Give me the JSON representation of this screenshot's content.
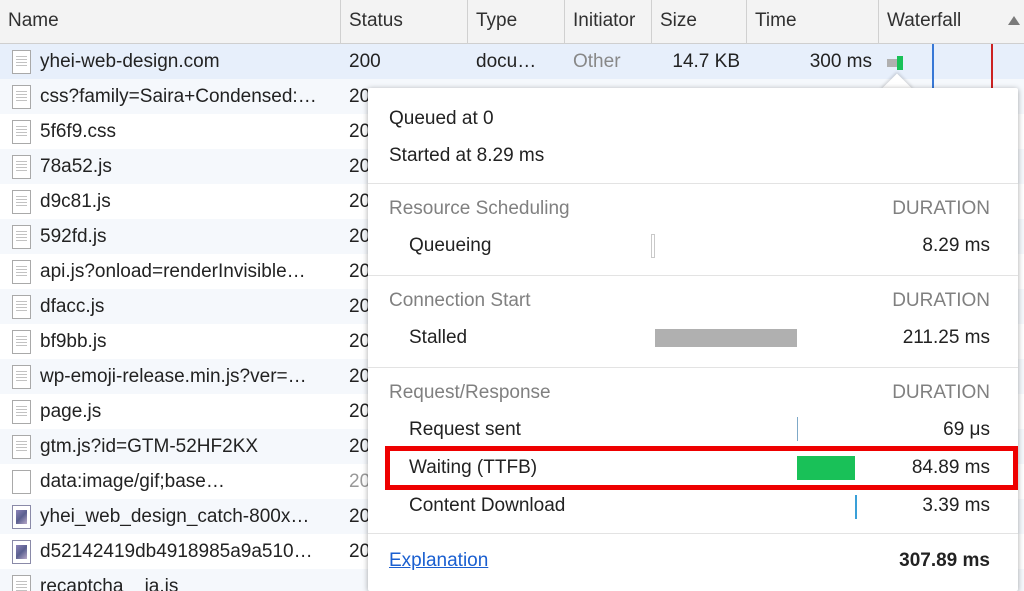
{
  "columns": {
    "name": "Name",
    "status": "Status",
    "type": "Type",
    "initiator": "Initiator",
    "size": "Size",
    "time": "Time",
    "waterfall": "Waterfall"
  },
  "rows": [
    {
      "name": "yhei-web-design.com",
      "status": "200",
      "type": "docu…",
      "initiator": "Other",
      "size": "14.7 KB",
      "time": "300 ms",
      "icon": "document-icon"
    },
    {
      "name": "css?family=Saira+Condensed:…",
      "status": "20",
      "icon": "document-icon"
    },
    {
      "name": "5f6f9.css",
      "status": "20",
      "icon": "document-icon"
    },
    {
      "name": "78a52.js",
      "status": "20",
      "icon": "document-icon"
    },
    {
      "name": "d9c81.js",
      "status": "20",
      "icon": "document-icon"
    },
    {
      "name": "592fd.js",
      "status": "20",
      "icon": "document-icon"
    },
    {
      "name": "api.js?onload=renderInvisible…",
      "status": "20",
      "icon": "document-icon"
    },
    {
      "name": "dfacc.js",
      "status": "20",
      "icon": "document-icon"
    },
    {
      "name": "bf9bb.js",
      "status": "20",
      "icon": "document-icon"
    },
    {
      "name": "wp-emoji-release.min.js?ver=…",
      "status": "20",
      "icon": "document-icon"
    },
    {
      "name": "page.js",
      "status": "20",
      "icon": "document-icon"
    },
    {
      "name": "gtm.js?id=GTM-52HF2KX",
      "status": "20",
      "icon": "document-icon"
    },
    {
      "name": "data:image/gif;base…",
      "status": "20",
      "icon": "blank-file-icon"
    },
    {
      "name": "yhei_web_design_catch-800x…",
      "status": "20",
      "icon": "image-file-icon"
    },
    {
      "name": "d52142419db4918985a9a510…",
      "status": "20",
      "icon": "image-file-icon"
    },
    {
      "name": "recaptcha__ja.js",
      "status": "",
      "icon": "document-icon"
    }
  ],
  "timing": {
    "queued_at": "Queued at 0",
    "started_at": "Started at 8.29 ms",
    "sections": [
      {
        "title": "Resource Scheduling",
        "duration_header": "DURATION",
        "entries": [
          {
            "label": "Queueing",
            "value": "8.29 ms"
          }
        ]
      },
      {
        "title": "Connection Start",
        "duration_header": "DURATION",
        "entries": [
          {
            "label": "Stalled",
            "value": "211.25 ms"
          }
        ]
      },
      {
        "title": "Request/Response",
        "duration_header": "DURATION",
        "entries": [
          {
            "label": "Request sent",
            "value": "69 μs"
          },
          {
            "label": "Waiting (TTFB)",
            "value": "84.89 ms"
          },
          {
            "label": "Content Download",
            "value": "3.39 ms"
          }
        ]
      }
    ],
    "explanation_link": "Explanation",
    "total": "307.89 ms"
  },
  "colors": {
    "waiting_green": "#19c158",
    "stalled_gray": "#b0b0b0",
    "download_blue": "#3878d6",
    "highlight_red": "#ee0000",
    "selected_row": "#e7effb"
  }
}
